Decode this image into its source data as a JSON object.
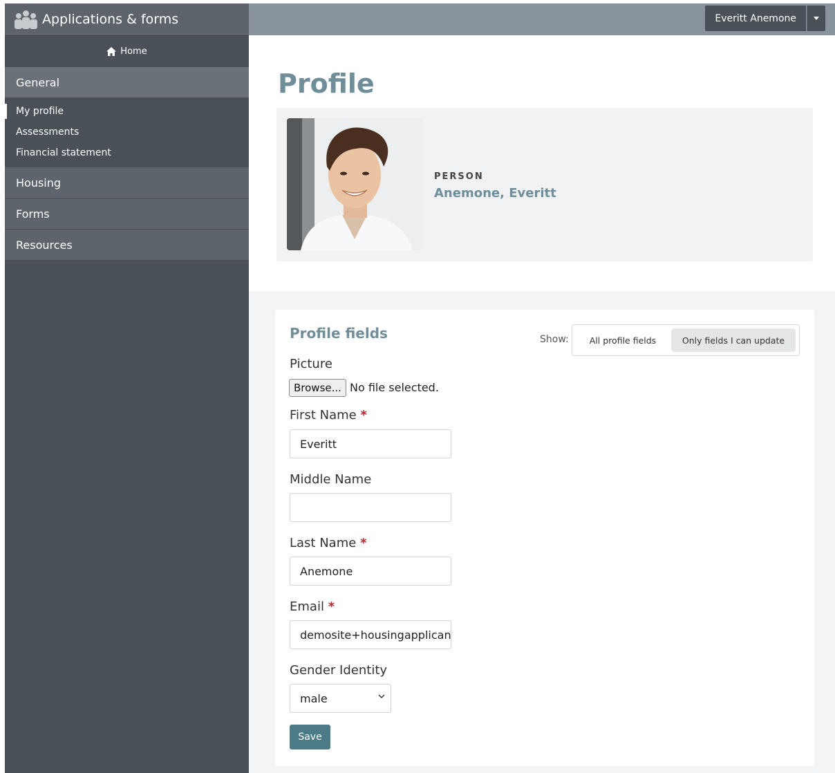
{
  "sidebar": {
    "app_title": "Applications & forms",
    "home_label": "Home",
    "sections": [
      {
        "label": "General"
      },
      {
        "label": "Housing"
      },
      {
        "label": "Forms"
      },
      {
        "label": "Resources"
      }
    ],
    "general_items": [
      {
        "label": "My profile",
        "active": true
      },
      {
        "label": "Assessments"
      },
      {
        "label": "Financial statement"
      }
    ]
  },
  "topbar": {
    "user_name": "Everitt Anemone"
  },
  "profile": {
    "page_title": "Profile",
    "person_label": "PERSON",
    "person_name": "Anemone, Everitt"
  },
  "fields": {
    "title": "Profile fields",
    "show_label": "Show:",
    "filter_options": [
      "All profile fields",
      "Only fields I can update"
    ],
    "filter_selected": "Only fields I can update",
    "picture_label": "Picture",
    "browse_label": "Browse...",
    "no_file_text": "No file selected.",
    "first_name_label": "First Name",
    "first_name_value": "Everitt",
    "middle_name_label": "Middle Name",
    "middle_name_value": "",
    "last_name_label": "Last Name",
    "last_name_value": "Anemone",
    "email_label": "Email",
    "email_value": "demosite+housingapplicant",
    "gender_label": "Gender Identity",
    "gender_value": "male",
    "required_mark": "*",
    "save_label": "Save"
  },
  "colors": {
    "sidebar_bg": "#4a5057",
    "topbar_bg": "#8a949c",
    "accent": "#6f8e99",
    "save_button": "#4c7a87",
    "required": "#b02a2a"
  }
}
